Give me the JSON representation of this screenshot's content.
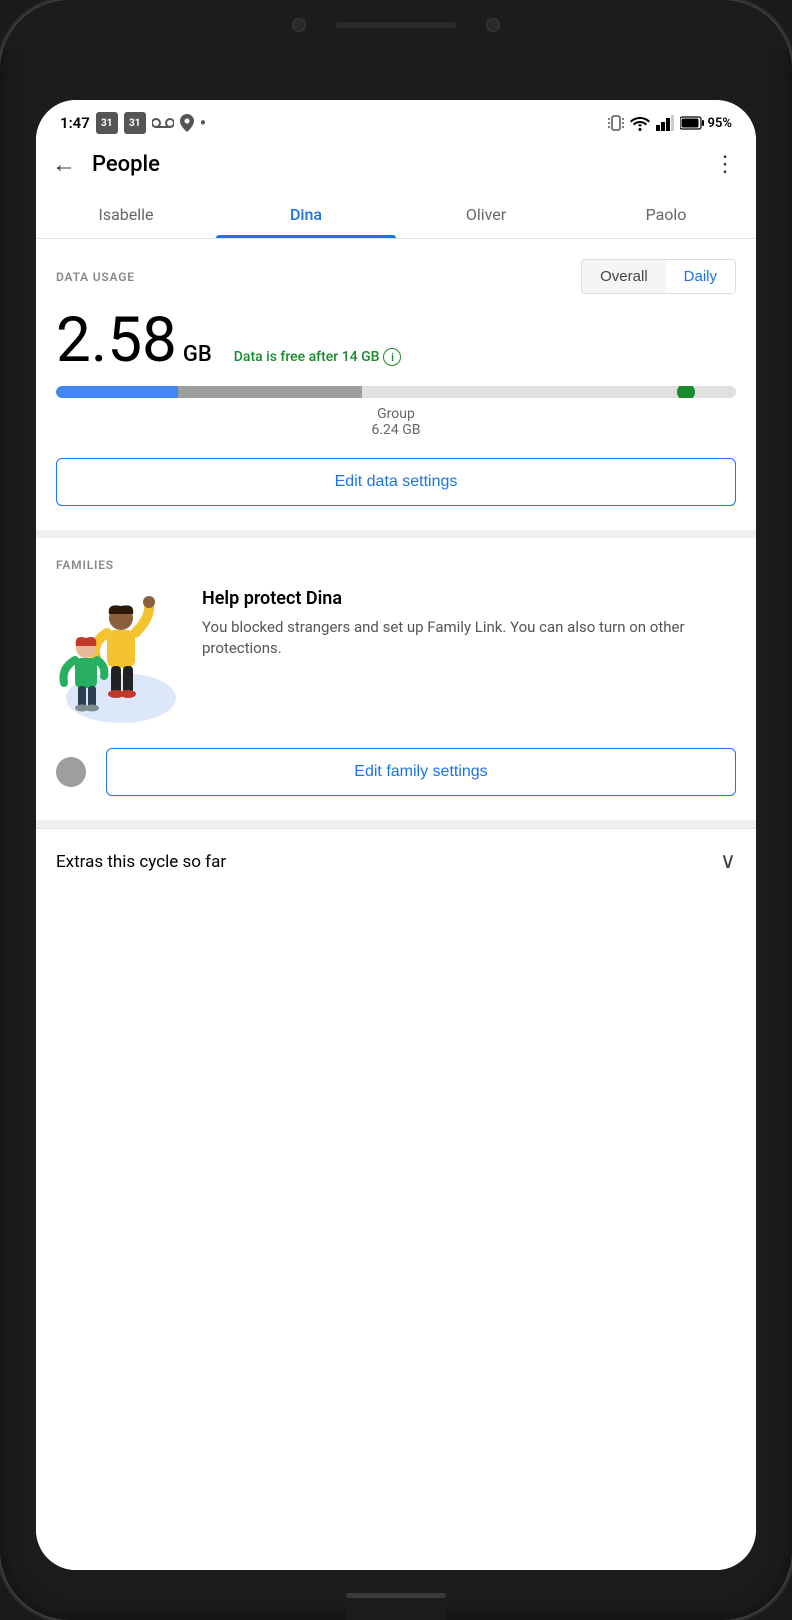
{
  "status_bar": {
    "time": "1:47",
    "battery": "95%",
    "icons": [
      "calendar-31",
      "calendar-31",
      "voicemail",
      "location",
      "dot"
    ]
  },
  "top_bar": {
    "title": "People",
    "back_label": "←",
    "more_label": "⋮"
  },
  "tabs": [
    {
      "label": "Isabelle",
      "active": false
    },
    {
      "label": "Dina",
      "active": true
    },
    {
      "label": "Oliver",
      "active": false
    },
    {
      "label": "Paolo",
      "active": false
    }
  ],
  "data_usage": {
    "section_label": "DATA USAGE",
    "toggle_overall": "Overall",
    "toggle_daily": "Daily",
    "amount": "2.58",
    "unit": "GB",
    "free_note": "Data is free after 14 GB",
    "group_label": "Group",
    "group_amount": "6.24 GB",
    "edit_button": "Edit data settings",
    "progress_blue_pct": 18,
    "progress_gray_pct": 27
  },
  "families": {
    "section_label": "FAMILIES",
    "title": "Help protect Dina",
    "description": "You blocked strangers and set up Family Link. You can also turn on other protections.",
    "edit_button": "Edit family settings"
  },
  "extras": {
    "title": "Extras this cycle so far",
    "chevron": "∨"
  }
}
